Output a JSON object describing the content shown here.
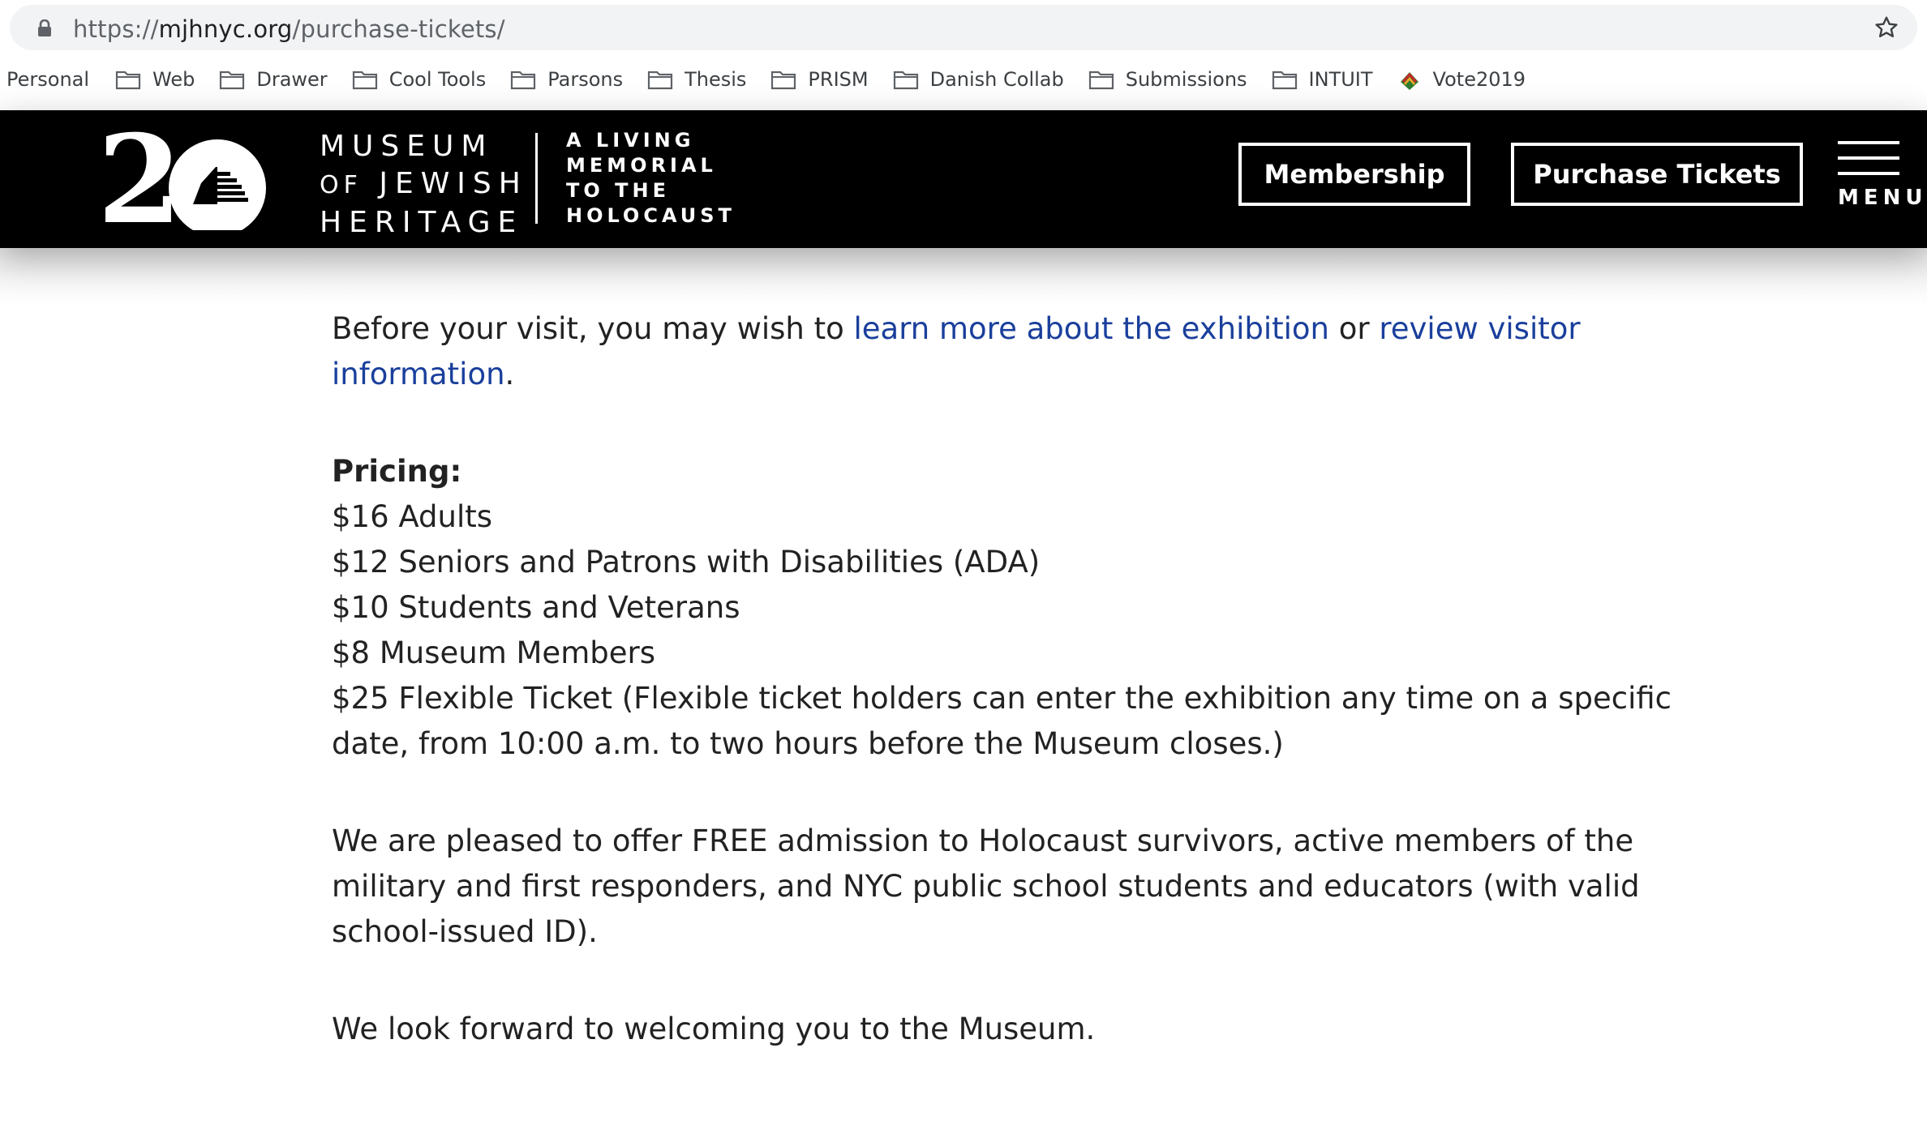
{
  "browser": {
    "url_scheme": "https://",
    "url_host": "mjhnyc.org",
    "url_path": "/purchase-tickets/",
    "bookmarks": [
      "Personal",
      "Web",
      "Drawer",
      "Cool Tools",
      "Parsons",
      "Thesis",
      "PRISM",
      "Danish Collab",
      "Submissions",
      "INTUIT",
      "Vote2019"
    ]
  },
  "header": {
    "logo_number": "20",
    "museum_line1": "MUSEUM",
    "museum_line2_small": "OF",
    "museum_line2": "JEWISH",
    "museum_line3": "HERITAGE",
    "tagline": [
      "A LIVING",
      "MEMORIAL",
      "TO THE",
      "HOLOCAUST"
    ],
    "membership_label": "Membership",
    "tickets_label": "Purchase Tickets",
    "menu_label": "MENU"
  },
  "content": {
    "visit_prefix": "Before your visit, you may wish to ",
    "visit_link1": "learn more about the exhibition",
    "visit_mid": " or ",
    "visit_link2": "review visitor information",
    "visit_suffix": ".",
    "pricing_heading": "Pricing:",
    "prices": [
      "$16 Adults",
      "$12 Seniors and Patrons with Disabilities (ADA)",
      "$10 Students and Veterans",
      "$8 Museum Members",
      "$25 Flexible Ticket (Flexible ticket holders can enter the exhibition any time on a specific date, from 10:00 a.m. to two hours before the Museum closes.)"
    ],
    "free_admission": "We are pleased to offer FREE admission to Holocaust survivors, active members of the military and first responders, and NYC public school students and educators (with valid school-issued ID).",
    "closing": "We look forward to welcoming you to the Museum."
  },
  "colors": {
    "link": "#1a3f9c",
    "header_bg": "#000000",
    "header_text": "#ffffff"
  }
}
